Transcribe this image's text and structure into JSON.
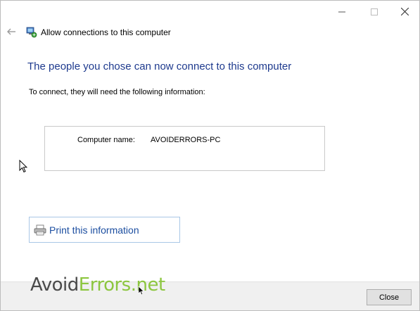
{
  "window": {
    "title_bar_buttons": [
      "minimize",
      "maximize",
      "close"
    ]
  },
  "header": {
    "back_icon": "back-arrow-icon",
    "wizard_icon": "network-computer-icon",
    "title": "Allow connections to this computer"
  },
  "content": {
    "heading": "The people you chose can now connect to this computer",
    "instruction": "To connect, they will need the following information:",
    "info": {
      "label": "Computer name:",
      "value": "AVOIDERRORS-PC"
    },
    "print_link": {
      "icon": "printer-icon",
      "label": "Print this information"
    }
  },
  "footer": {
    "close_label": "Close"
  },
  "watermark": {
    "part1": "Avoid",
    "part2": "Errors",
    "part3": ".net"
  },
  "colors": {
    "heading": "#1e3a8e",
    "link": "#1c4ea0",
    "watermark_gray": "#4a4a4a",
    "watermark_green": "#8cc63f"
  }
}
